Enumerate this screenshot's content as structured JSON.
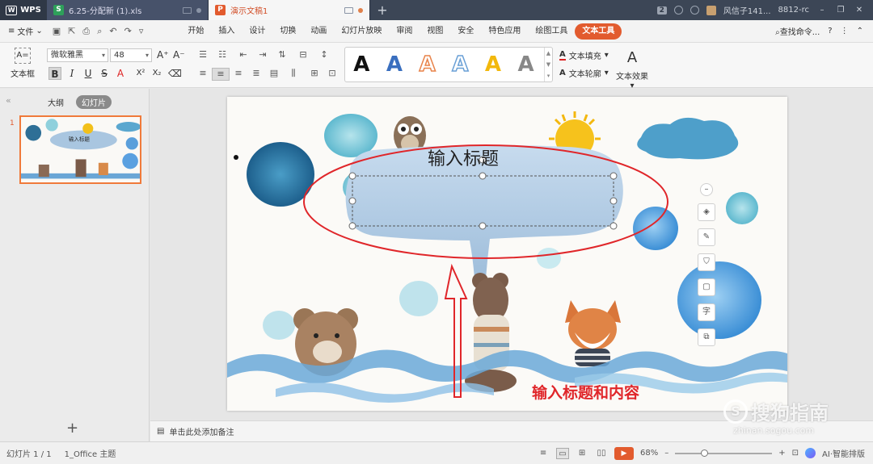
{
  "titlebar": {
    "app_name": "WPS",
    "tabs": [
      {
        "label": "6.25-分配新 (1).xls",
        "icon": "S",
        "color": "#2ea05a"
      },
      {
        "label": "演示文稿1",
        "icon": "P",
        "color": "#e25b2e"
      }
    ],
    "new_tab": "+",
    "badge": "2",
    "user_name": "风信子141...",
    "user_id": "8812-rc"
  },
  "menubar": {
    "file": "文件",
    "tabs": [
      "开始",
      "插入",
      "设计",
      "切换",
      "动画",
      "幻灯片放映",
      "审阅",
      "视图",
      "安全",
      "特色应用",
      "绘图工具",
      "文本工具"
    ],
    "active_tab": "文本工具",
    "search": "查找命令..."
  },
  "ribbon": {
    "textbox_label": "文本框",
    "font_name": "微软雅黑",
    "font_size": "48",
    "style_letter": "A",
    "styles": [
      {
        "color": "#111111",
        "outline": "none"
      },
      {
        "color": "#3a6fbf",
        "outline": "none"
      },
      {
        "color": "#ffffff",
        "outline": "#e8834a"
      },
      {
        "color": "#ffffff",
        "outline": "#6aa0d6"
      },
      {
        "color": "#f2b80c",
        "outline": "none"
      },
      {
        "color": "#888888",
        "outline": "none"
      }
    ],
    "text_fill": "文本填充",
    "text_outline": "文本轮廓",
    "text_effect": "文本效果"
  },
  "left_panel": {
    "tab_outline": "大纲",
    "tab_slides": "幻灯片",
    "slide_number": "1",
    "thumb_title": "输入标题",
    "add_slide": "+"
  },
  "slide": {
    "title_placeholder": "输入标题",
    "annotation": "输入标题和内容",
    "annotation_color": "#e0262a"
  },
  "float_tools": {
    "text_btn": "字"
  },
  "notes": {
    "placeholder": "单击此处添加备注"
  },
  "statusbar": {
    "slide_info": "幻灯片 1 / 1",
    "theme": "1_Office 主题",
    "zoom": "68%",
    "ai_label": "AI·智能排版"
  },
  "watermark": {
    "brand": "搜狗指南",
    "url": "zhinan.sogou.com"
  }
}
